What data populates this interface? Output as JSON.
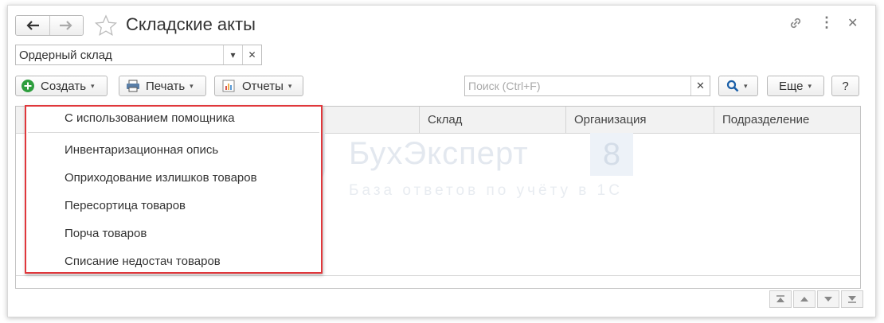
{
  "window": {
    "title": "Складские акты",
    "back_icon": "arrow-left-icon",
    "forward_icon": "arrow-right-icon",
    "favorite_icon": "star-icon",
    "link_icon": "link-icon",
    "more_icon": "more-vertical-icon",
    "close_icon": "close-icon"
  },
  "filter": {
    "warehouse_value": "Ордерный склад",
    "dropdown_icon": "caret-down-icon",
    "clear_icon": "close-icon"
  },
  "toolbar": {
    "create_label": "Создать",
    "print_label": "Печать",
    "reports_label": "Отчеты",
    "search_placeholder": "Поиск (Ctrl+F)",
    "more_label": "Еще",
    "help_label": "?"
  },
  "table": {
    "columns": [
      "Склад",
      "Организация",
      "Подразделение"
    ]
  },
  "create_menu": {
    "items": [
      "С использованием помощника",
      "Инвентаризационная опись",
      "Оприходование излишков товаров",
      "Пересортица товаров",
      "Порча товаров",
      "Списание недостач товаров"
    ]
  },
  "watermark": {
    "brand": "БухЭксперт",
    "badge": "8",
    "tagline": "База ответов по учёту в 1С"
  },
  "colors": {
    "accent_green": "#2e9e3e",
    "menu_border": "#e0373b",
    "search_icon": "#1a5fa8"
  }
}
